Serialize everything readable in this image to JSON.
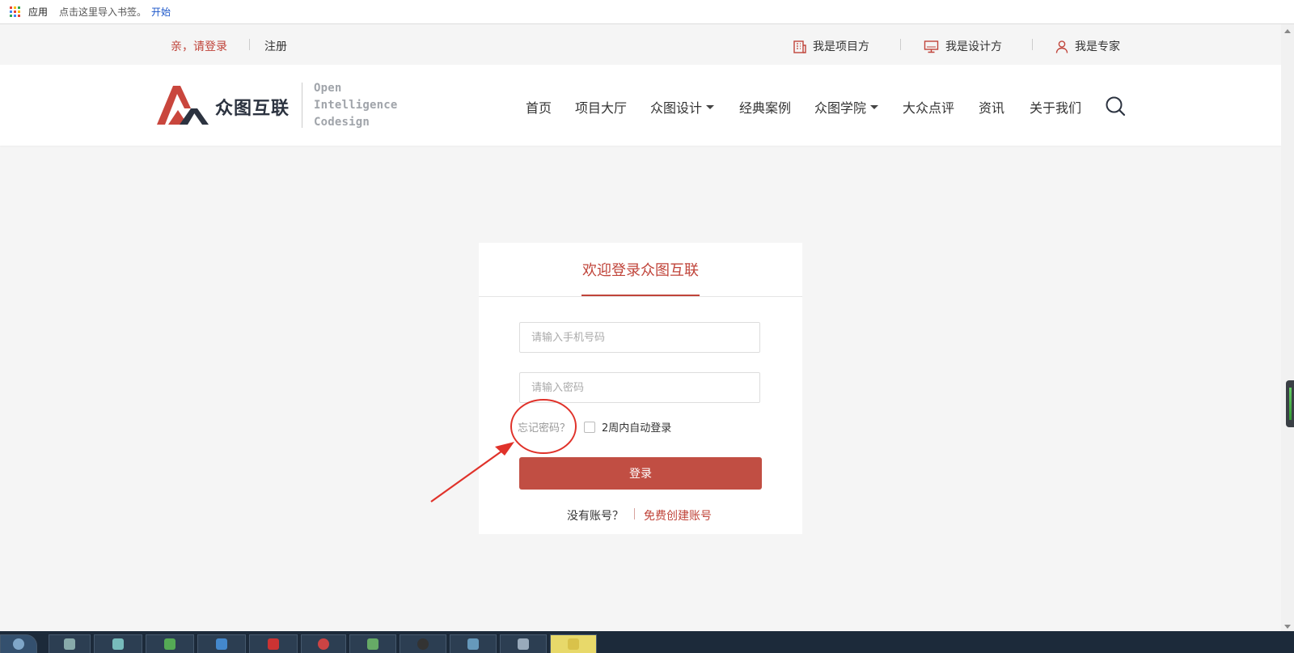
{
  "bookmarks": {
    "apps_label": "应用",
    "hint": "点击这里导入书签。",
    "start_link": "开始"
  },
  "topbar": {
    "login": "亲，请登录",
    "register": "注册",
    "roles": [
      "我是项目方",
      "我是设计方",
      "我是专家"
    ]
  },
  "header": {
    "logo_text": "众图互联",
    "logo_en": [
      "Open",
      "Intelligence",
      "Codesign"
    ],
    "nav": [
      {
        "label": "首页"
      },
      {
        "label": "项目大厅"
      },
      {
        "label": "众图设计"
      },
      {
        "label": "经典案例"
      },
      {
        "label": "众图学院"
      },
      {
        "label": "大众点评"
      },
      {
        "label": "资讯"
      },
      {
        "label": "关于我们"
      }
    ]
  },
  "login": {
    "title": "欢迎登录众图互联",
    "phone_placeholder": "请输入手机号码",
    "password_placeholder": "请输入密码",
    "forgot": "忘记密码？",
    "remember": "2周内自动登录",
    "submit": "登录",
    "no_account": "没有账号？",
    "create": "免费创建账号"
  },
  "colors": {
    "accent": "#c0443a",
    "button": "#c14e43"
  }
}
